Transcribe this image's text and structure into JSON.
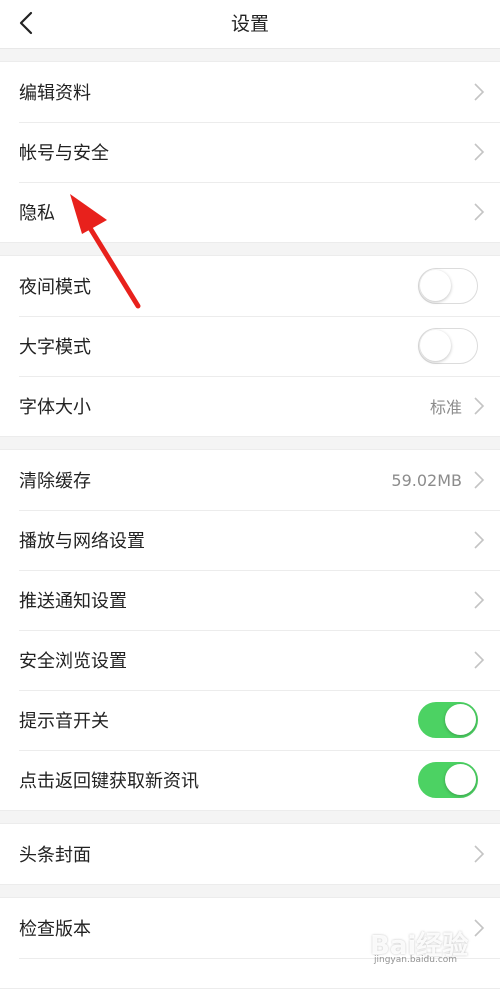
{
  "header": {
    "title": "设置",
    "back_icon": "back-arrow-icon"
  },
  "groups": {
    "account": [
      {
        "label": "编辑资料"
      },
      {
        "label": "帐号与安全"
      },
      {
        "label": "隐私"
      }
    ],
    "display": {
      "night_mode": {
        "label": "夜间模式",
        "on": false
      },
      "large_text": {
        "label": "大字模式",
        "on": false
      },
      "font_size": {
        "label": "字体大小",
        "value": "标准"
      }
    },
    "general": {
      "clear_cache": {
        "label": "清除缓存",
        "value": "59.02MB"
      },
      "playback": {
        "label": "播放与网络设置"
      },
      "push": {
        "label": "推送通知设置"
      },
      "safe_browse": {
        "label": "安全浏览设置"
      },
      "sound": {
        "label": "提示音开关",
        "on": true
      },
      "back_refresh": {
        "label": "点击返回键获取新资讯",
        "on": true
      }
    },
    "cover": {
      "label": "头条封面"
    },
    "about": {
      "label": "检查版本"
    }
  },
  "colors": {
    "toggle_on": "#4cd263",
    "annotation_arrow": "#e8211c"
  },
  "watermark": {
    "text": "Bai经验",
    "sub": "jingyan.baidu.com"
  }
}
